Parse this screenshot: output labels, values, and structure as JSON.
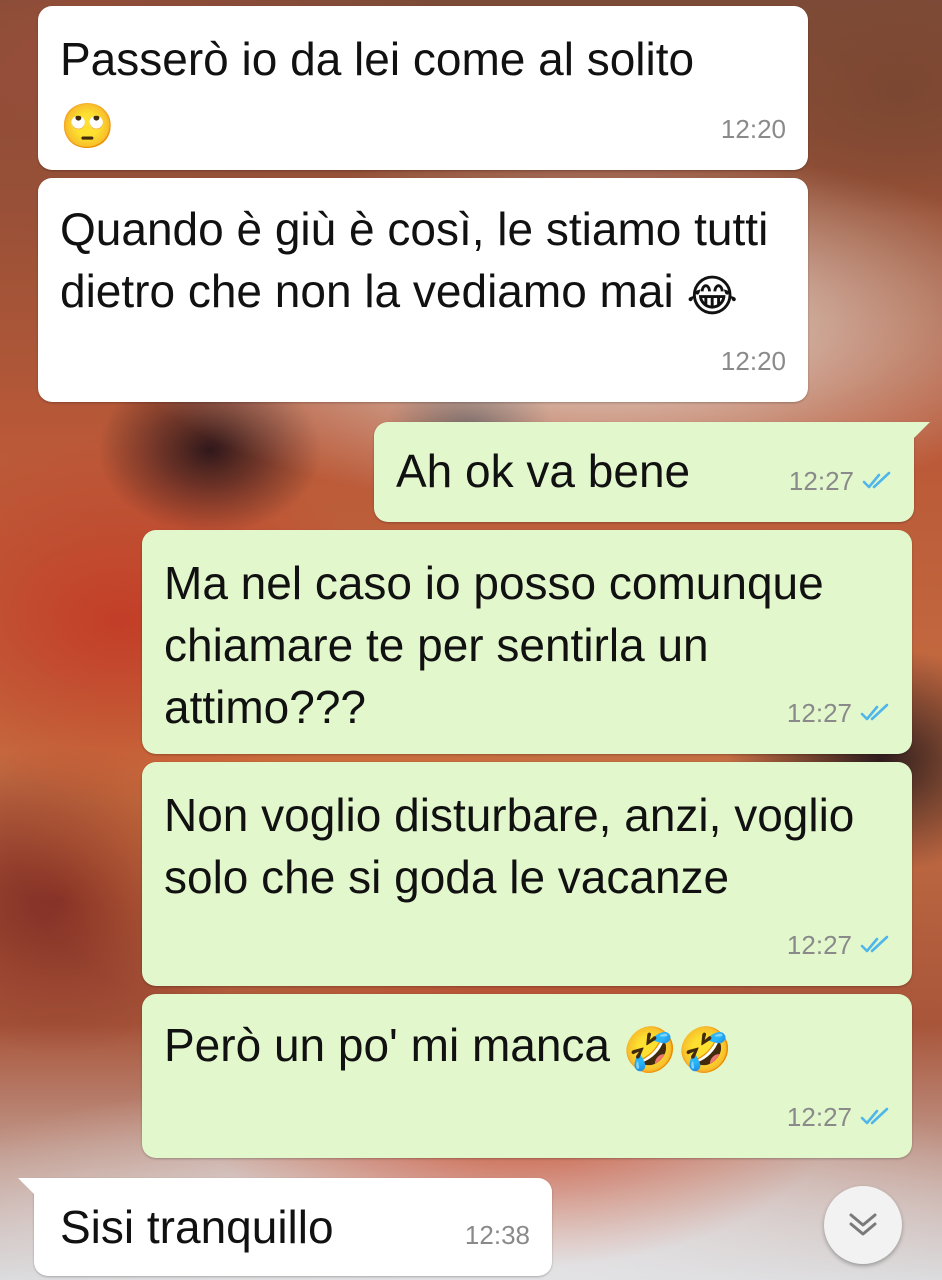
{
  "messages": [
    {
      "id": "m1",
      "direction": "incoming",
      "text": "Passerò io da lei come al solito",
      "emoji": "🙄",
      "time": "12:20"
    },
    {
      "id": "m2",
      "direction": "incoming",
      "text": "Quando è giù è così, le stiamo tutti dietro che non la vediamo mai",
      "emoji": "😂",
      "time": "12:20"
    },
    {
      "id": "m3",
      "direction": "outgoing",
      "text": "Ah ok va bene",
      "time": "12:27",
      "status": "read"
    },
    {
      "id": "m4",
      "direction": "outgoing",
      "text": "Ma nel caso io posso comunque chiamare te per sentirla un attimo???",
      "time": "12:27",
      "status": "read"
    },
    {
      "id": "m5",
      "direction": "outgoing",
      "text": "Non voglio disturbare, anzi, voglio solo che si goda le vacanze",
      "time": "12:27",
      "status": "read"
    },
    {
      "id": "m6",
      "direction": "outgoing",
      "text": "Però un po' mi manca",
      "emoji": "🤣🤣",
      "time": "12:27",
      "status": "read"
    },
    {
      "id": "m7",
      "direction": "incoming",
      "text": "Sisi tranquillo",
      "time": "12:38"
    }
  ],
  "colors": {
    "incoming_bubble": "#ffffff",
    "outgoing_bubble": "#e2f8cc",
    "read_ticks": "#4fb6ec",
    "timestamp": "#8a8a8a"
  },
  "icons": {
    "read_status": "double-check-icon",
    "scroll_down": "double-chevron-down-icon"
  }
}
